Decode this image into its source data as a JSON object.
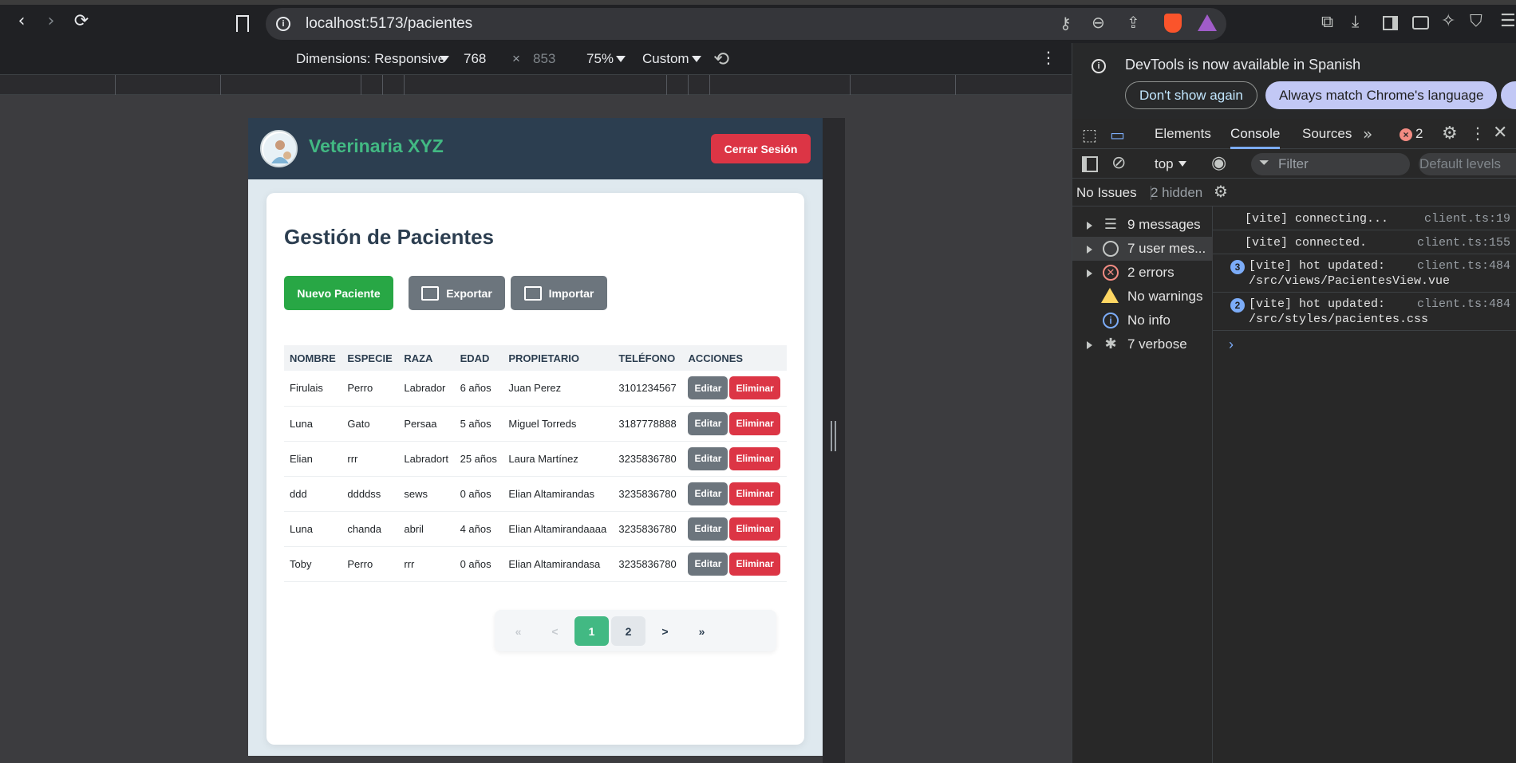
{
  "browser": {
    "url": "localhost:5173/pacientes"
  },
  "device_toolbar": {
    "dimensions_label": "Dimensions: Responsive",
    "width": "768",
    "times": "×",
    "height": "853",
    "zoom": "75%",
    "throttle": "Custom"
  },
  "app": {
    "brand": "Veterinaria XYZ",
    "logout_label": "Cerrar Sesión",
    "page_title": "Gestión de Pacientes",
    "actions": {
      "new_label": "Nuevo Paciente",
      "export_label": "Exportar",
      "import_label": "Importar"
    },
    "table": {
      "headers": [
        "NOMBRE",
        "ESPECIE",
        "RAZA",
        "EDAD",
        "PROPIETARIO",
        "TELÉFONO",
        "ACCIONES"
      ],
      "edit_label": "Editar",
      "delete_label": "Eliminar",
      "rows": [
        [
          "Firulais",
          "Perro",
          "Labrador",
          "6 años",
          "Juan Perez",
          "3101234567"
        ],
        [
          "Luna",
          "Gato",
          "Persaa",
          "5 años",
          "Miguel Torreds",
          "3187778888"
        ],
        [
          "Elian",
          "rrr",
          "Labradort",
          "25 años",
          "Laura Martínez",
          "3235836780"
        ],
        [
          "ddd",
          "ddddss",
          "sews",
          "0 años",
          "Elian Altamirandas",
          "3235836780"
        ],
        [
          "Luna",
          "chanda",
          "abril",
          "4 años",
          "Elian Altamirandaaaa",
          "3235836780"
        ],
        [
          "Toby",
          "Perro",
          "rrr",
          "0 años",
          "Elian Altamirandasa",
          "3235836780"
        ]
      ]
    },
    "pagination": {
      "first": "«",
      "prev": "<",
      "pages": [
        "1",
        "2"
      ],
      "active_page": "1",
      "next": ">",
      "last": "»"
    }
  },
  "devtools": {
    "banner_text": "DevTools is now available in Spanish",
    "dont_show_label": "Don't show again",
    "match_language_label": "Always match Chrome's language",
    "tabs": [
      "Elements",
      "Console",
      "Sources"
    ],
    "active_tab": "Console",
    "error_count": "2",
    "context": "top",
    "filter_placeholder": "Filter",
    "levels": "Default levels",
    "issues": "No Issues",
    "hidden": "2 hidden",
    "sidebar": [
      {
        "label": "9 messages",
        "icon": "list-icon"
      },
      {
        "label": "7 user mes...",
        "icon": "user-icon"
      },
      {
        "label": "2 errors",
        "icon": "error-icon"
      },
      {
        "label": "No warnings",
        "icon": "warning-icon"
      },
      {
        "label": "No info",
        "icon": "info-icon"
      },
      {
        "label": "7 verbose",
        "icon": "bug-icon"
      }
    ],
    "logs": [
      {
        "text": "[vite] connecting...",
        "source": "client.ts:19",
        "count": ""
      },
      {
        "text": "[vite] connected.",
        "source": "client.ts:155",
        "count": ""
      },
      {
        "text": "[vite] hot updated:",
        "text2": "/src/views/PacientesView.vue",
        "source": "client.ts:484",
        "count": "3"
      },
      {
        "text": "[vite] hot updated:",
        "text2": "/src/styles/pacientes.css",
        "source": "client.ts:484",
        "count": "2"
      }
    ],
    "colors": {
      "accent": "#7cacf8",
      "error": "#f28b82",
      "warning": "#fdd663"
    }
  },
  "colors": {
    "brand_green": "#42b983",
    "header_dark": "#2c3e50",
    "danger": "#dc3545",
    "success": "#28a745",
    "secondary": "#6c757d"
  }
}
